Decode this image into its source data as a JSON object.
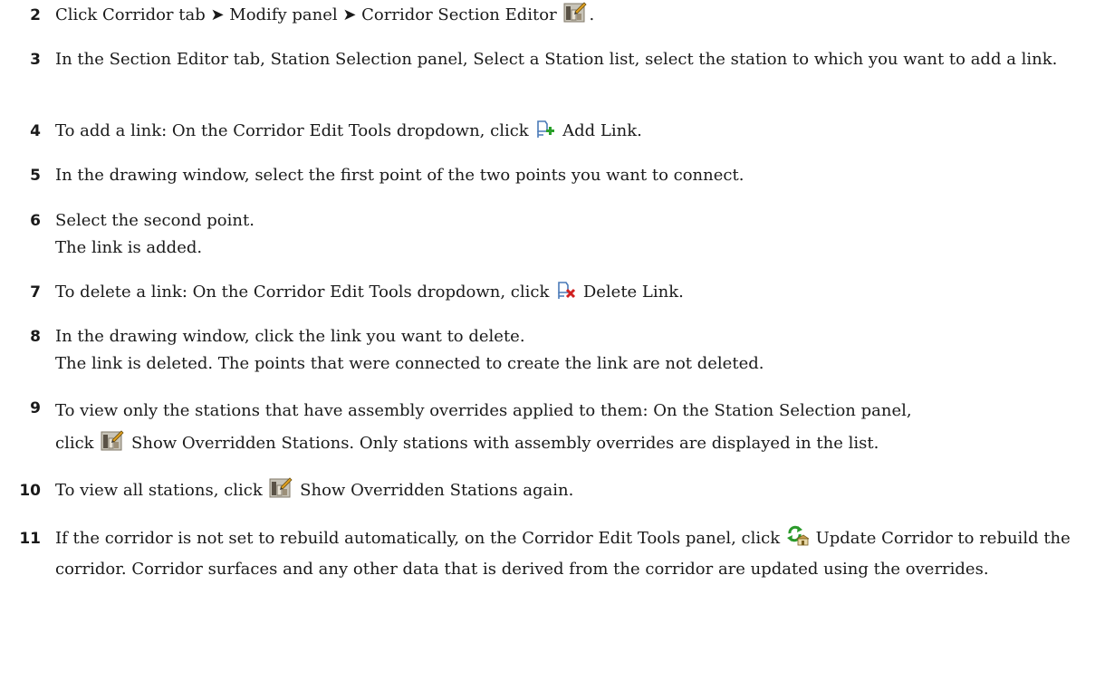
{
  "steps": [
    {
      "num": "2",
      "text": "Click Corridor tab ➤ Modify panel ➤ Corridor Section Editor ",
      "text_end": ".",
      "icon": "corridor-section-editor-icon"
    },
    {
      "num": "3",
      "text": "In the Section Editor tab, Station Selection panel, Select a Station list, select the station to which you want to add a link."
    },
    {
      "num": "4",
      "text": "To add a link: On the Corridor Edit Tools dropdown, click ",
      "text_end": " Add Link.",
      "icon": "add-link-icon"
    },
    {
      "num": "5",
      "text": "In the drawing window, select the first point of the two points you want to connect."
    },
    {
      "num": "6",
      "text": "Select the second point.",
      "result": "The link is added."
    },
    {
      "num": "7",
      "text": "To delete a link: On the Corridor Edit Tools dropdown, click ",
      "text_end": " Delete Link.",
      "icon": "delete-link-icon"
    },
    {
      "num": "8",
      "text": "In the drawing window, click the link you want to delete.",
      "result": "The link is deleted. The points that were connected to create the link are not deleted."
    },
    {
      "num": "9",
      "text": "To view only the stations that have assembly overrides applied to them: On the Station Selection panel,",
      "text_pre": "click ",
      "text_end": " Show Overridden Stations. Only stations with assembly overrides are displayed in the list.",
      "icon": "show-overridden-stations-icon"
    },
    {
      "num": "10",
      "text": "To view all stations, click ",
      "text_end": " Show Overridden Stations again.",
      "icon": "show-overridden-stations-icon"
    },
    {
      "num": "11",
      "text": "If the corridor is not set to rebuild automatically, on the Corridor Edit Tools panel, click ",
      "text_end": " Update Corridor to rebuild the corridor. Corridor surfaces and any other data that is derived from the corridor are updated using the overrides.",
      "icon": "update-corridor-icon"
    }
  ]
}
